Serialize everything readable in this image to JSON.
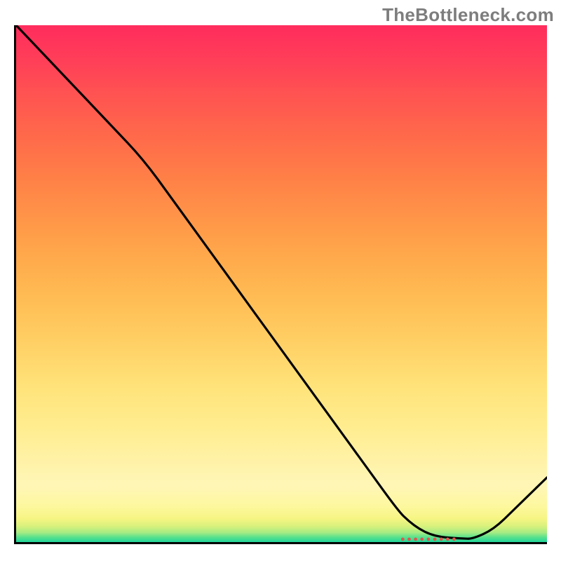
{
  "watermark": "TheBottleneck.com",
  "marker_text": "●●●●●●●●●",
  "chart_data": {
    "type": "line",
    "title": "",
    "xlabel": "",
    "ylabel": "",
    "xlim": [
      0,
      100
    ],
    "ylim": [
      0,
      100
    ],
    "grid": false,
    "legend": false,
    "x": [
      0,
      6,
      12,
      18,
      24,
      30,
      36,
      42,
      48,
      54,
      60,
      66,
      72,
      74,
      76,
      78,
      80,
      82,
      84,
      86,
      90,
      94,
      98,
      100
    ],
    "values": [
      100,
      93.5,
      87,
      80.5,
      74,
      65.5,
      57,
      48.5,
      40,
      31.5,
      23,
      14.5,
      6,
      4,
      2.5,
      1.5,
      1,
      0.8,
      0.7,
      0.6,
      2.5,
      6.5,
      10.5,
      12.5
    ],
    "annotations": [
      {
        "text": "●●●●●●●●●",
        "x": 80,
        "y": 1,
        "color": "#e0554d"
      }
    ],
    "background_gradient": {
      "direction": "vertical",
      "stops": [
        {
          "pos": 0.0,
          "color": "#ff2c5d"
        },
        {
          "pos": 0.07,
          "color": "#ff3f58"
        },
        {
          "pos": 0.14,
          "color": "#ff5551"
        },
        {
          "pos": 0.22,
          "color": "#ff6b4a"
        },
        {
          "pos": 0.3,
          "color": "#ff8147"
        },
        {
          "pos": 0.38,
          "color": "#ff9748"
        },
        {
          "pos": 0.46,
          "color": "#ffac4c"
        },
        {
          "pos": 0.54,
          "color": "#ffbf56"
        },
        {
          "pos": 0.62,
          "color": "#ffd166"
        },
        {
          "pos": 0.7,
          "color": "#ffe37a"
        },
        {
          "pos": 0.78,
          "color": "#ffed90"
        },
        {
          "pos": 0.84,
          "color": "#fff2a6"
        },
        {
          "pos": 0.89,
          "color": "#fff6b7"
        },
        {
          "pos": 0.93,
          "color": "#fdf89f"
        },
        {
          "pos": 0.955,
          "color": "#f6f583"
        },
        {
          "pos": 0.97,
          "color": "#d6f17c"
        },
        {
          "pos": 0.982,
          "color": "#a4eb84"
        },
        {
          "pos": 0.99,
          "color": "#5de28c"
        },
        {
          "pos": 1.0,
          "color": "#1fd59a"
        }
      ]
    }
  }
}
